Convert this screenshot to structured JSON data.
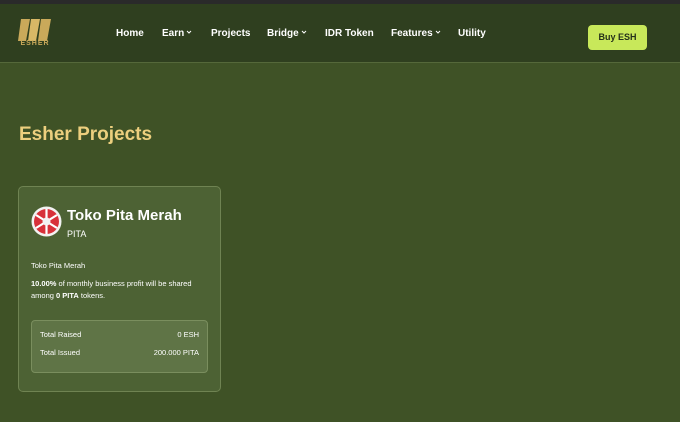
{
  "brand": {
    "logo_text": "ESHER"
  },
  "nav": {
    "items": [
      {
        "label": "Home",
        "dropdown": false
      },
      {
        "label": "Earn",
        "dropdown": true
      },
      {
        "label": "Projects",
        "dropdown": false
      },
      {
        "label": "Bridge",
        "dropdown": true
      },
      {
        "label": "IDR Token",
        "dropdown": false
      },
      {
        "label": "Features",
        "dropdown": true
      },
      {
        "label": "Utility",
        "dropdown": false
      }
    ],
    "buy_label": "Buy ESH"
  },
  "page": {
    "title": "Esher Projects"
  },
  "project": {
    "name": "Toko Pita Merah",
    "symbol": "PITA",
    "description": "Toko Pita Merah",
    "share_percent": "10.00%",
    "share_text_mid": " of monthly business profit will be shared among ",
    "share_tokens": "0 PITA",
    "share_text_end": " tokens.",
    "stats": {
      "total_raised_label": "Total Raised",
      "total_raised_value": "0 ESH",
      "total_issued_label": "Total Issued",
      "total_issued_value": "200.000 PITA"
    }
  },
  "colors": {
    "background": "#3f5226",
    "navbar": "#2f3f1f",
    "accent_button": "#c8e85a",
    "title": "#eccf7e",
    "card": "#4d6234"
  }
}
